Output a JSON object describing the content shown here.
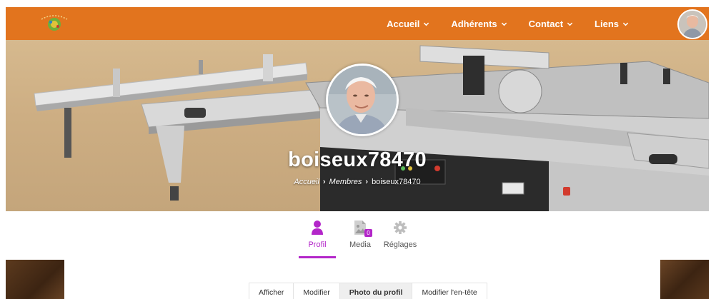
{
  "nav": {
    "items": [
      {
        "label": "Accueil"
      },
      {
        "label": "Adhérents"
      },
      {
        "label": "Contact"
      },
      {
        "label": "Liens"
      }
    ]
  },
  "profile": {
    "username": "boiseux78470",
    "breadcrumb": {
      "home": "Accueil",
      "members": "Membres",
      "current": "boiseux78470"
    }
  },
  "profile_tabs": {
    "profil": "Profil",
    "media": "Media",
    "media_count": "0",
    "reglages": "Réglages"
  },
  "sub_tabs": {
    "afficher": "Afficher",
    "modifier": "Modifier",
    "photo": "Photo du profil",
    "entete": "Modifier l'en-tête"
  },
  "colors": {
    "topbar": "#e2741e",
    "accent": "#b326c9"
  }
}
